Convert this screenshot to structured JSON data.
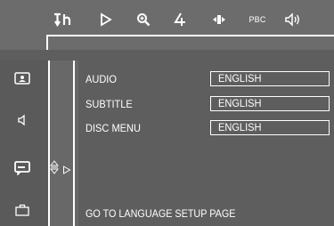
{
  "top_icons": [
    "audio-settings-icon",
    "play-icon",
    "zoom-icon",
    "angle-icon",
    "step-icon",
    "pbc-label",
    "sound-icon"
  ],
  "pbc_label": "PBC",
  "side_icons": [
    "picture-icon",
    "speaker-icon",
    "subtitle-icon",
    "briefcase-icon"
  ],
  "rows": [
    {
      "label": "AUDIO",
      "value": "ENGLISH"
    },
    {
      "label": "SUBTITLE",
      "value": "ENGLISH"
    },
    {
      "label": "DISC MENU",
      "value": "ENGLISH"
    }
  ],
  "footer": "GO TO LANGUAGE SETUP PAGE",
  "colors": {
    "background": "#686868",
    "panel": "#5e5e5e",
    "text": "#ffffff"
  }
}
